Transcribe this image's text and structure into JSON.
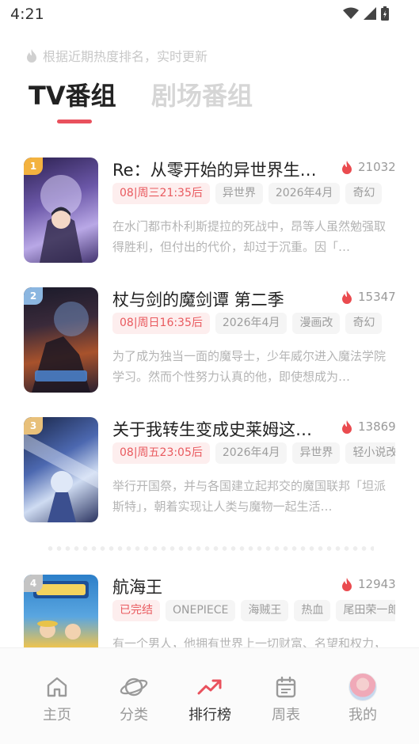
{
  "status_bar": {
    "time": "4:21"
  },
  "hint": "根据近期热度排名，实时更新",
  "tabs": [
    {
      "label": "TV番组",
      "active": true
    },
    {
      "label": "剧场番组",
      "active": false
    }
  ],
  "items": [
    {
      "rank": "1",
      "rank_color": "#f3b23f",
      "title": "Re：从零开始的异世界生活 第四季",
      "heat": "21032",
      "tags": [
        {
          "label": "08|周三21:35后",
          "hot": true
        },
        {
          "label": "异世界",
          "hot": false
        },
        {
          "label": "2026年4月",
          "hot": false
        },
        {
          "label": "奇幻",
          "hot": false
        }
      ],
      "desc": "在水门都市朴利斯提拉的死战中，昂等人虽然勉强取得胜利，但付出的代价，却过于沉重。因「…",
      "cover_colors": [
        "#3b2d6b",
        "#8a76c8",
        "#cfc4ec"
      ]
    },
    {
      "rank": "2",
      "rank_color": "#8bb6e0",
      "title": "杖与剑的魔剑谭 第二季",
      "heat": "15347",
      "tags": [
        {
          "label": "08|周日16:35后",
          "hot": true
        },
        {
          "label": "2026年4月",
          "hot": false
        },
        {
          "label": "漫画改",
          "hot": false
        },
        {
          "label": "奇幻",
          "hot": false
        }
      ],
      "desc": "为了成为独当一面的魔导士，少年威尔进入魔法学院学习。然而个性努力认真的他，即使想成为…",
      "cover_colors": [
        "#2a1d1a",
        "#a8522c",
        "#6f8fc4"
      ]
    },
    {
      "rank": "3",
      "rank_color": "#e8c07a",
      "title": "关于我转生变成史莱姆这档事 第四季",
      "heat": "13869",
      "tags": [
        {
          "label": "08|周五23:05后",
          "hot": true
        },
        {
          "label": "2026年4月",
          "hot": false
        },
        {
          "label": "异世界",
          "hot": false
        },
        {
          "label": "轻小说改",
          "hot": false
        }
      ],
      "desc": "举行开国祭，并与各国建立起邦交的魔国联邦「坦派斯特」，朝着实现让人类与魔物一起生活…",
      "cover_colors": [
        "#1e2b52",
        "#6b8ad0",
        "#d7e4f5"
      ]
    },
    {
      "rank": "4",
      "rank_color": "#c4c4c4",
      "title": "航海王",
      "heat": "12943",
      "tags": [
        {
          "label": "已完结",
          "hot": true
        },
        {
          "label": "ONEPIECE",
          "hot": false
        },
        {
          "label": "海贼王",
          "hot": false
        },
        {
          "label": "热血",
          "hot": false
        },
        {
          "label": "尾田荣一郎",
          "hot": false
        }
      ],
      "desc": "有一个男人，他拥有世界上一切财富、名望和权力，他就是海贼王哥尔·D·罗杰…",
      "cover_colors": [
        "#2c7fc9",
        "#f2c44b",
        "#d9463a"
      ]
    }
  ],
  "bottom_nav": [
    {
      "label": "主页",
      "icon": "home-icon",
      "active": false
    },
    {
      "label": "分类",
      "icon": "planet-icon",
      "active": false
    },
    {
      "label": "排行榜",
      "icon": "trending-icon",
      "active": true
    },
    {
      "label": "周表",
      "icon": "calendar-icon",
      "active": false
    },
    {
      "label": "我的",
      "icon": "avatar",
      "active": false
    }
  ],
  "colors": {
    "accent": "#e9515d",
    "tag_hot_text": "#e95a5f"
  }
}
